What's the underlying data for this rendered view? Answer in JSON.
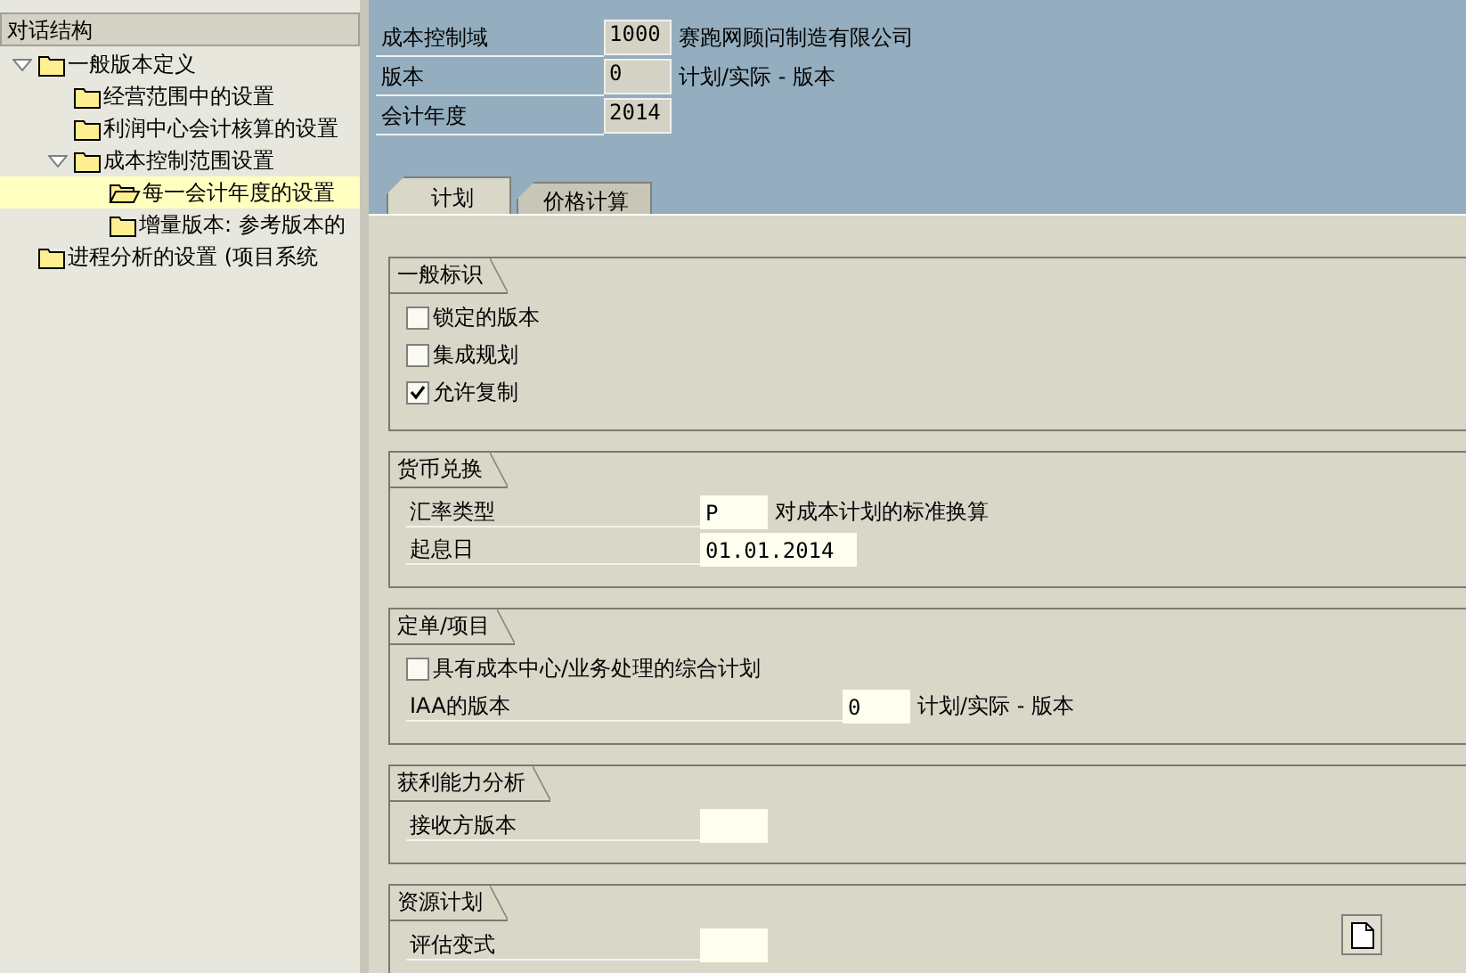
{
  "tree": {
    "title": "对话结构",
    "items": [
      {
        "label": "一般版本定义",
        "expanded": true,
        "selected": false,
        "children": [
          {
            "label": "经营范围中的设置",
            "selected": false
          },
          {
            "label": "利润中心会计核算的设置",
            "selected": false
          },
          {
            "label": "成本控制范围设置",
            "expanded": true,
            "selected": false,
            "children": [
              {
                "label": "每一会计年度的设置",
                "selected": true
              },
              {
                "label": "增量版本: 参考版本的",
                "selected": false
              }
            ]
          }
        ]
      },
      {
        "label": "进程分析的设置 (项目系统",
        "selected": false
      }
    ]
  },
  "header": [
    {
      "label": "成本控制域",
      "value": "1000",
      "desc": "赛跑网顾问制造有限公司"
    },
    {
      "label": "版本",
      "value": "0",
      "desc": "计划/实际 - 版本"
    },
    {
      "label": "会计年度",
      "value": "2014"
    }
  ],
  "tabs": [
    {
      "label": "计划",
      "selected": true
    },
    {
      "label": "价格计算",
      "selected": false
    }
  ],
  "groups": [
    {
      "title": "一般标识",
      "rows": [
        {
          "kind": "checkbox",
          "label": "锁定的版本",
          "checked": false
        },
        {
          "kind": "checkbox",
          "label": "集成规划",
          "checked": false
        },
        {
          "kind": "checkbox",
          "label": "允许复制",
          "checked": true
        }
      ]
    },
    {
      "title": "货币兑换",
      "rows": [
        {
          "kind": "field",
          "label": "汇率类型",
          "value": "P",
          "desc": "对成本计划的标准换算"
        },
        {
          "kind": "field",
          "label": "起息日",
          "value": "01.01.2014"
        }
      ]
    },
    {
      "title": "定单/项目",
      "rows": [
        {
          "kind": "checkbox",
          "label": "具有成本中心/业务处理的综合计划",
          "checked": false
        },
        {
          "kind": "field",
          "label": "IAA的版本",
          "value": "0",
          "desc": "计划/实际 - 版本"
        }
      ]
    },
    {
      "title": "获利能力分析",
      "rows": [
        {
          "kind": "field",
          "label": "接收方版本"
        }
      ]
    },
    {
      "title": "资源计划",
      "rows": [
        {
          "kind": "field",
          "label": "评估变式"
        }
      ]
    }
  ]
}
